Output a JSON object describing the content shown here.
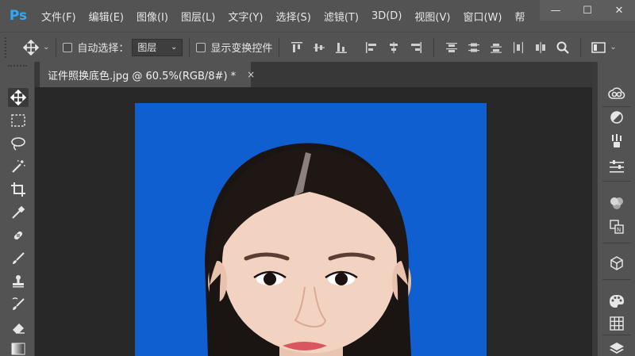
{
  "app": {
    "logo": "Ps"
  },
  "menu": [
    "文件(F)",
    "编辑(E)",
    "图像(I)",
    "图层(L)",
    "文字(Y)",
    "选择(S)",
    "滤镜(T)",
    "3D(D)",
    "视图(V)",
    "窗口(W)",
    "帮"
  ],
  "window_controls": {
    "minimize": "—",
    "maximize": "☐",
    "close": "✕"
  },
  "options": {
    "auto_select_label": "自动选择：",
    "auto_select_value": "图层",
    "show_transform_label": "显示变换控件"
  },
  "document_tab": {
    "title": "证件照换底色.jpg @ 60.5%(RGB/8#) *",
    "close": "×"
  },
  "colors": {
    "chrome": "#535353",
    "canvas": "#282828",
    "photo_bg": "#0f5fd0",
    "accent": "#31a8ff"
  },
  "tools_left": [
    "move-tool-icon",
    "marquee-tool-icon",
    "lasso-tool-icon",
    "magic-wand-tool-icon",
    "crop-tool-icon",
    "eyedropper-tool-icon",
    "healing-brush-tool-icon",
    "brush-tool-icon",
    "clone-stamp-tool-icon",
    "history-brush-tool-icon",
    "eraser-tool-icon",
    "gradient-tool-icon"
  ],
  "panels_right": [
    "creative-cloud-icon",
    "adjustments-icon",
    "brushes-icon",
    "properties-icon",
    "color-icon",
    "character-icon",
    "3d-icon",
    "swatches-icon",
    "grid-icon",
    "layers-icon"
  ]
}
